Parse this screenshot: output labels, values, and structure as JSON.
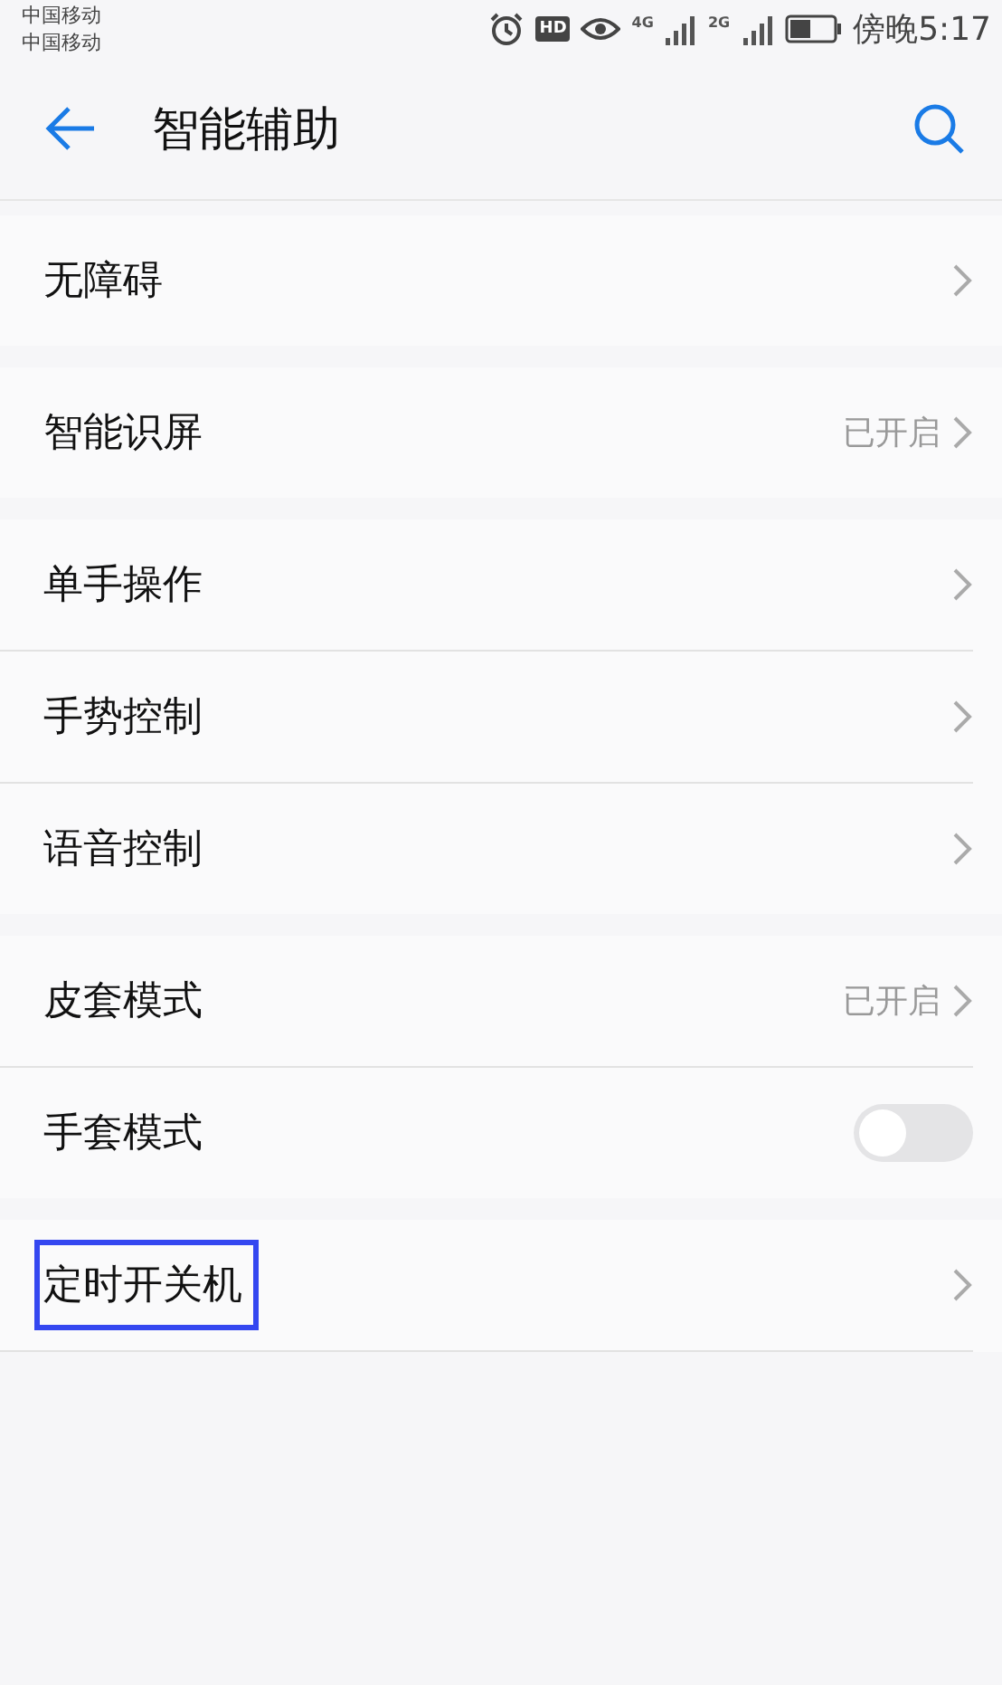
{
  "status_bar": {
    "carriers": [
      "中国移动",
      "中国移动"
    ],
    "hd_badge": "HD",
    "networks": [
      "4G",
      "2G"
    ],
    "time": "傍晚5:17"
  },
  "header": {
    "title": "智能辅助"
  },
  "groups": [
    {
      "rows": [
        {
          "kind": "link",
          "label": "无障碍",
          "highlighted": false
        }
      ]
    },
    {
      "rows": [
        {
          "kind": "link",
          "label": "智能识屏",
          "value": "已开启",
          "highlighted": false
        }
      ]
    },
    {
      "rows": [
        {
          "kind": "link",
          "label": "单手操作",
          "highlighted": false
        },
        {
          "kind": "link",
          "label": "手势控制",
          "highlighted": false
        },
        {
          "kind": "link",
          "label": "语音控制",
          "highlighted": false
        }
      ]
    },
    {
      "rows": [
        {
          "kind": "link",
          "label": "皮套模式",
          "value": "已开启",
          "highlighted": false
        },
        {
          "kind": "toggle",
          "label": "手套模式",
          "on": false,
          "highlighted": false
        }
      ]
    },
    {
      "rows": [
        {
          "kind": "link",
          "label": "定时开关机",
          "highlighted": true
        }
      ]
    }
  ]
}
